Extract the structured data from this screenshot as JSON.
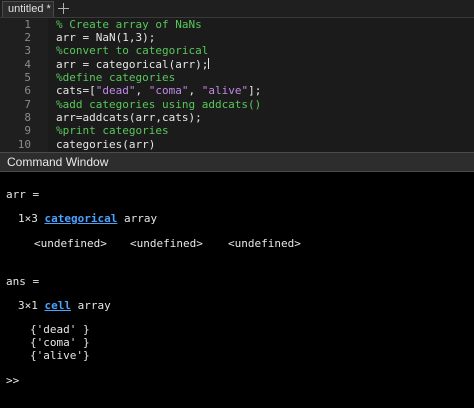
{
  "tab": {
    "label": "untitled *"
  },
  "editor": {
    "line_numbers": [
      "1",
      "2",
      "3",
      "4",
      "5",
      "6",
      "7",
      "8",
      "9",
      "10"
    ],
    "lines": [
      "% Create array of NaNs",
      "arr = NaN(1,3);",
      "%convert to categorical",
      "arr = categorical(arr);",
      "%define categories",
      "cats=[",
      "%add categories using addcats()",
      "arr=addcats(arr,cats);",
      "%print categories",
      "categories(arr)"
    ],
    "cats_strings": [
      "\"dead\"",
      "\"coma\"",
      "\"alive\""
    ],
    "cats_sep": ", ",
    "cats_end": "];"
  },
  "command_window": {
    "title": "Command Window",
    "arr_label": "arr =",
    "arr_size_prefix": "1×3 ",
    "arr_type_link": "categorical",
    "arr_size_suffix": " array",
    "undefined": [
      "<undefined>",
      "<undefined>",
      "<undefined>"
    ],
    "ans_label": "ans =",
    "ans_size_prefix": "3×1 ",
    "ans_type_link": "cell",
    "ans_size_suffix": " array",
    "cells": [
      "{'dead' }",
      "{'coma' }",
      "{'alive'}"
    ],
    "prompt": ">>"
  }
}
